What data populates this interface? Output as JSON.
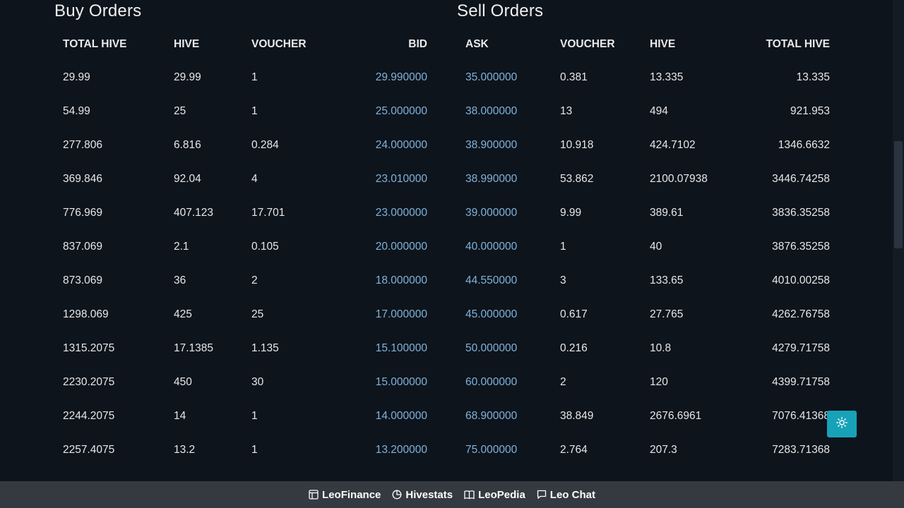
{
  "buy": {
    "title": "Buy Orders",
    "headers": [
      "TOTAL HIVE",
      "HIVE",
      "VOUCHER",
      "BID"
    ],
    "rows": [
      [
        "29.99",
        "29.99",
        "1",
        "29.990000"
      ],
      [
        "54.99",
        "25",
        "1",
        "25.000000"
      ],
      [
        "277.806",
        "6.816",
        "0.284",
        "24.000000"
      ],
      [
        "369.846",
        "92.04",
        "4",
        "23.010000"
      ],
      [
        "776.969",
        "407.123",
        "17.701",
        "23.000000"
      ],
      [
        "837.069",
        "2.1",
        "0.105",
        "20.000000"
      ],
      [
        "873.069",
        "36",
        "2",
        "18.000000"
      ],
      [
        "1298.069",
        "425",
        "25",
        "17.000000"
      ],
      [
        "1315.2075",
        "17.1385",
        "1.135",
        "15.100000"
      ],
      [
        "2230.2075",
        "450",
        "30",
        "15.000000"
      ],
      [
        "2244.2075",
        "14",
        "1",
        "14.000000"
      ],
      [
        "2257.4075",
        "13.2",
        "1",
        "13.200000"
      ]
    ]
  },
  "sell": {
    "title": "Sell Orders",
    "headers": [
      "ASK",
      "VOUCHER",
      "HIVE",
      "TOTAL HIVE"
    ],
    "rows": [
      [
        "35.000000",
        "0.381",
        "13.335",
        "13.335"
      ],
      [
        "38.000000",
        "13",
        "494",
        "921.953"
      ],
      [
        "38.900000",
        "10.918",
        "424.7102",
        "1346.6632"
      ],
      [
        "38.990000",
        "53.862",
        "2100.07938",
        "3446.74258"
      ],
      [
        "39.000000",
        "9.99",
        "389.61",
        "3836.35258"
      ],
      [
        "40.000000",
        "1",
        "40",
        "3876.35258"
      ],
      [
        "44.550000",
        "3",
        "133.65",
        "4010.00258"
      ],
      [
        "45.000000",
        "0.617",
        "27.765",
        "4262.76758"
      ],
      [
        "50.000000",
        "0.216",
        "10.8",
        "4279.71758"
      ],
      [
        "60.000000",
        "2",
        "120",
        "4399.71758"
      ],
      [
        "68.900000",
        "38.849",
        "2676.6961",
        "7076.41368"
      ],
      [
        "75.000000",
        "2.764",
        "207.3",
        "7283.71368"
      ]
    ]
  },
  "footer": {
    "links": [
      {
        "label": "LeoFinance",
        "icon": "layout-icon"
      },
      {
        "label": "Hivestats",
        "icon": "pie-chart-icon"
      },
      {
        "label": "LeoPedia",
        "icon": "book-icon"
      },
      {
        "label": "Leo Chat",
        "icon": "chat-icon"
      }
    ]
  },
  "theme_toggle": {
    "icon": "sun-icon",
    "color": "#17a2b8"
  },
  "colors": {
    "background": "#0e141b",
    "price": "#7fb3dd",
    "footer": "#343a40"
  }
}
